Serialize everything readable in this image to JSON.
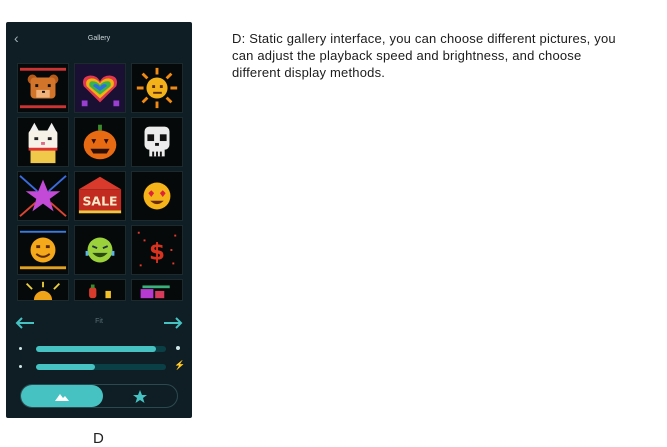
{
  "app": {
    "title": "Gallery"
  },
  "header": {
    "back_icon": "chevron-left-icon"
  },
  "gallery": {
    "items": [
      {
        "name": "teddy-bear"
      },
      {
        "name": "rainbow-heart"
      },
      {
        "name": "sun"
      },
      {
        "name": "lucky-cat"
      },
      {
        "name": "pumpkin"
      },
      {
        "name": "skull"
      },
      {
        "name": "star"
      },
      {
        "name": "sale-sign"
      },
      {
        "name": "heart-eyes-emoji"
      },
      {
        "name": "smile-emoji"
      },
      {
        "name": "laughing-emoji"
      },
      {
        "name": "dollar-sign"
      },
      {
        "name": "partial-sun"
      },
      {
        "name": "partial-fruit"
      },
      {
        "name": "partial-scene"
      }
    ]
  },
  "controls": {
    "mode_label": "Fit",
    "speed_level": 0.92,
    "brightness_level": 0.45
  },
  "mode_switch": {
    "static_icon": "mountain-image-icon",
    "animated_icon": "star-icon"
  },
  "colors": {
    "accent": "#46c2c2",
    "background": "#0f1e24"
  },
  "caption": {
    "letter": "D"
  },
  "description": "D: Static gallery interface, you can choose different pictures, you can adjust the playback speed and brightness, and choose different display methods."
}
